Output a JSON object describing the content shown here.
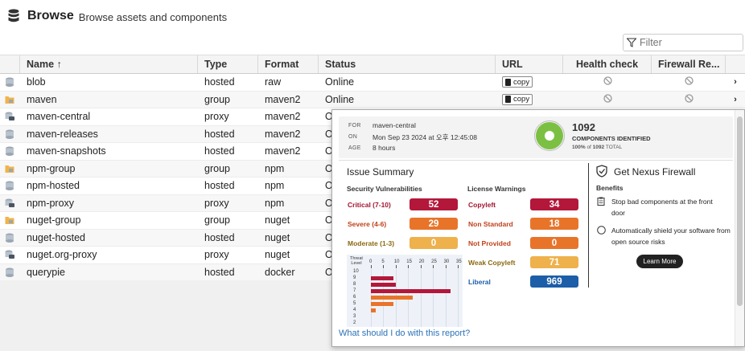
{
  "header": {
    "title": "Browse",
    "subtitle": "Browse assets and components"
  },
  "filter": {
    "placeholder": "Filter"
  },
  "table": {
    "columns": [
      "Name ↑",
      "Type",
      "Format",
      "Status",
      "URL",
      "Health check",
      "Firewall Re..."
    ],
    "copy_label": "copy",
    "rows": [
      {
        "name": "blob",
        "type": "hosted",
        "format": "raw",
        "status": "Online",
        "icon": "hosted-icon",
        "url": true
      },
      {
        "name": "maven",
        "type": "group",
        "format": "maven2",
        "status": "Online",
        "icon": "group-icon",
        "url": true
      },
      {
        "name": "maven-central",
        "type": "proxy",
        "format": "maven2",
        "status": "O",
        "icon": "proxy-icon"
      },
      {
        "name": "maven-releases",
        "type": "hosted",
        "format": "maven2",
        "status": "O",
        "icon": "hosted-icon"
      },
      {
        "name": "maven-snapshots",
        "type": "hosted",
        "format": "maven2",
        "status": "O",
        "icon": "hosted-icon"
      },
      {
        "name": "npm-group",
        "type": "group",
        "format": "npm",
        "status": "O",
        "icon": "group-icon"
      },
      {
        "name": "npm-hosted",
        "type": "hosted",
        "format": "npm",
        "status": "O",
        "icon": "hosted-icon"
      },
      {
        "name": "npm-proxy",
        "type": "proxy",
        "format": "npm",
        "status": "O",
        "icon": "proxy-icon"
      },
      {
        "name": "nuget-group",
        "type": "group",
        "format": "nuget",
        "status": "O",
        "icon": "group-icon"
      },
      {
        "name": "nuget-hosted",
        "type": "hosted",
        "format": "nuget",
        "status": "O",
        "icon": "hosted-icon"
      },
      {
        "name": "nuget.org-proxy",
        "type": "proxy",
        "format": "nuget",
        "status": "O",
        "icon": "proxy-icon"
      },
      {
        "name": "querypie",
        "type": "hosted",
        "format": "docker",
        "status": "O",
        "icon": "hosted-icon"
      }
    ]
  },
  "report": {
    "for_label": "FOR",
    "for_value": "maven-central",
    "on_label": "ON",
    "on_value": "Mon Sep 23 2024 at 오후 12:45:08",
    "age_label": "AGE",
    "age_value": "8 hours",
    "components_count": "1092",
    "components_label": "COMPONENTS IDENTIFIED",
    "pct": "100%",
    "of": "of",
    "total": "1092",
    "total_label": "TOTAL",
    "issue_summary": "Issue Summary",
    "security_title": "Security Vulnerabilities",
    "security": [
      {
        "label": "Critical (7-10)",
        "value": "52",
        "color": "#b3173a",
        "text_color": "#a01530"
      },
      {
        "label": "Severe (4-6)",
        "value": "29",
        "color": "#e8742a",
        "text_color": "#c0411b"
      },
      {
        "label": "Moderate (1-3)",
        "value": "0",
        "color": "#eeb14b",
        "text_color": "#8a6a10"
      }
    ],
    "license_title": "License Warnings",
    "license": [
      {
        "label": "Copyleft",
        "value": "34",
        "color": "#b3173a",
        "text_color": "#a01530"
      },
      {
        "label": "Non Standard",
        "value": "18",
        "color": "#e8742a",
        "text_color": "#c0411b"
      },
      {
        "label": "Not Provided",
        "value": "0",
        "color": "#e8742a",
        "text_color": "#c0411b"
      },
      {
        "label": "Weak Copyleft",
        "value": "71",
        "color": "#eeb14b",
        "text_color": "#8a6a10"
      },
      {
        "label": "Liberal",
        "value": "969",
        "color": "#1c5ea8",
        "text_color": "#1c5ea8"
      }
    ],
    "firewall_title": "Get Nexus Firewall",
    "benefits_title": "Benefits",
    "benefit_1": "Stop bad components at the front door",
    "benefit_2": "Automatically shield your software from open source risks",
    "learn_more": "Learn More",
    "what_link": "What should I do with this report?"
  },
  "chart_data": {
    "type": "bar",
    "title": "",
    "xlabel": "",
    "ylabel": "Threat Level",
    "x_ticks": [
      "0",
      "5",
      "10",
      "15",
      "20",
      "25",
      "30",
      "35"
    ],
    "xlim": [
      0,
      35
    ],
    "categories": [
      "10",
      "9",
      "8",
      "7",
      "6",
      "5",
      "4",
      "3",
      "2"
    ],
    "values": [
      0,
      9,
      10,
      32,
      17,
      9,
      2,
      0,
      0
    ],
    "colors": [
      "#b3173a",
      "#b3173a",
      "#b3173a",
      "#b3173a",
      "#e8742a",
      "#e8742a",
      "#e8742a",
      "#eeb14b",
      "#eeb14b"
    ],
    "grid": true
  }
}
